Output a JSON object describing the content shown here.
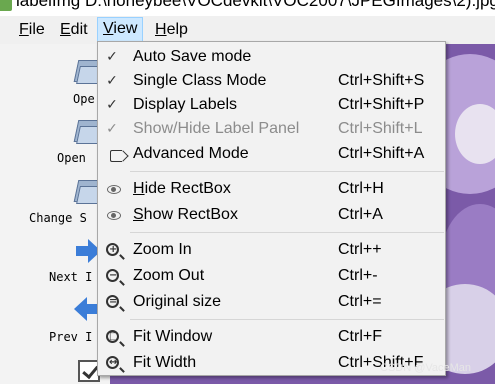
{
  "window": {
    "title": "labelImg D:\\honeybee\\VOCdevkit\\VOC2007\\JPEGImages\\2).jpg"
  },
  "menubar": {
    "items": [
      {
        "mnemonic": "F",
        "rest": "ile"
      },
      {
        "mnemonic": "E",
        "rest": "dit"
      },
      {
        "mnemonic": "V",
        "rest": "iew"
      },
      {
        "mnemonic": "H",
        "rest": "elp"
      }
    ]
  },
  "toolbar": {
    "items": [
      {
        "label": "Ope",
        "icon": "open-folder-icon"
      },
      {
        "label": "Open",
        "icon": "open-dir-folder-icon"
      },
      {
        "label": "Change S",
        "icon": "change-save-dir-folder-icon"
      },
      {
        "label": "Next I",
        "icon": "next-image-arrow-icon"
      },
      {
        "label": "Prev I",
        "icon": "prev-image-arrow-icon"
      },
      {
        "label": "",
        "icon": "verify-checkbox-icon"
      }
    ]
  },
  "view_menu": {
    "items": [
      {
        "label": "Auto Save mode",
        "shortcut": "",
        "icon": "checkmark-icon",
        "checked": true,
        "enabled": true
      },
      {
        "label": "Single Class Mode",
        "shortcut": "Ctrl+Shift+S",
        "icon": "checkmark-icon",
        "checked": true,
        "enabled": true
      },
      {
        "label": "Display Labels",
        "shortcut": "Ctrl+Shift+P",
        "icon": "checkmark-icon",
        "checked": true,
        "enabled": true
      },
      {
        "label": "Show/Hide Label Panel",
        "shortcut": "Ctrl+Shift+L",
        "icon": "checkmark-icon",
        "checked": true,
        "enabled": false
      },
      {
        "label": "Advanced Mode",
        "shortcut": "Ctrl+Shift+A",
        "icon": "expert-icon",
        "checked": false,
        "enabled": true
      },
      {
        "label_mnemonic": "H",
        "label_rest": "ide RectBox",
        "shortcut": "Ctrl+H",
        "icon": "eye-icon"
      },
      {
        "label_mnemonic": "S",
        "label_rest": "how RectBox",
        "shortcut": "Ctrl+A",
        "icon": "eye-icon"
      },
      {
        "label": "Zoom In",
        "shortcut": "Ctrl++",
        "icon": "zoom-in-icon",
        "glyph": "+"
      },
      {
        "label": "Zoom Out",
        "shortcut": "Ctrl+-",
        "icon": "zoom-out-icon",
        "glyph": "−"
      },
      {
        "label": "Original size",
        "shortcut": "Ctrl+=",
        "icon": "zoom-original-icon",
        "glyph": "="
      },
      {
        "label": "Fit Window",
        "shortcut": "Ctrl+F",
        "icon": "fit-window-icon",
        "glyph": "□"
      },
      {
        "label": "Fit Width",
        "shortcut": "Ctrl+Shift+F",
        "icon": "fit-width-icon",
        "glyph": "↔"
      }
    ]
  },
  "watermark": "CSDN @VaceMan",
  "colors": {
    "menu_highlight": "#cde8ff",
    "canvas": "#7b5aa8",
    "disabled_text": "#8c8c8c"
  }
}
